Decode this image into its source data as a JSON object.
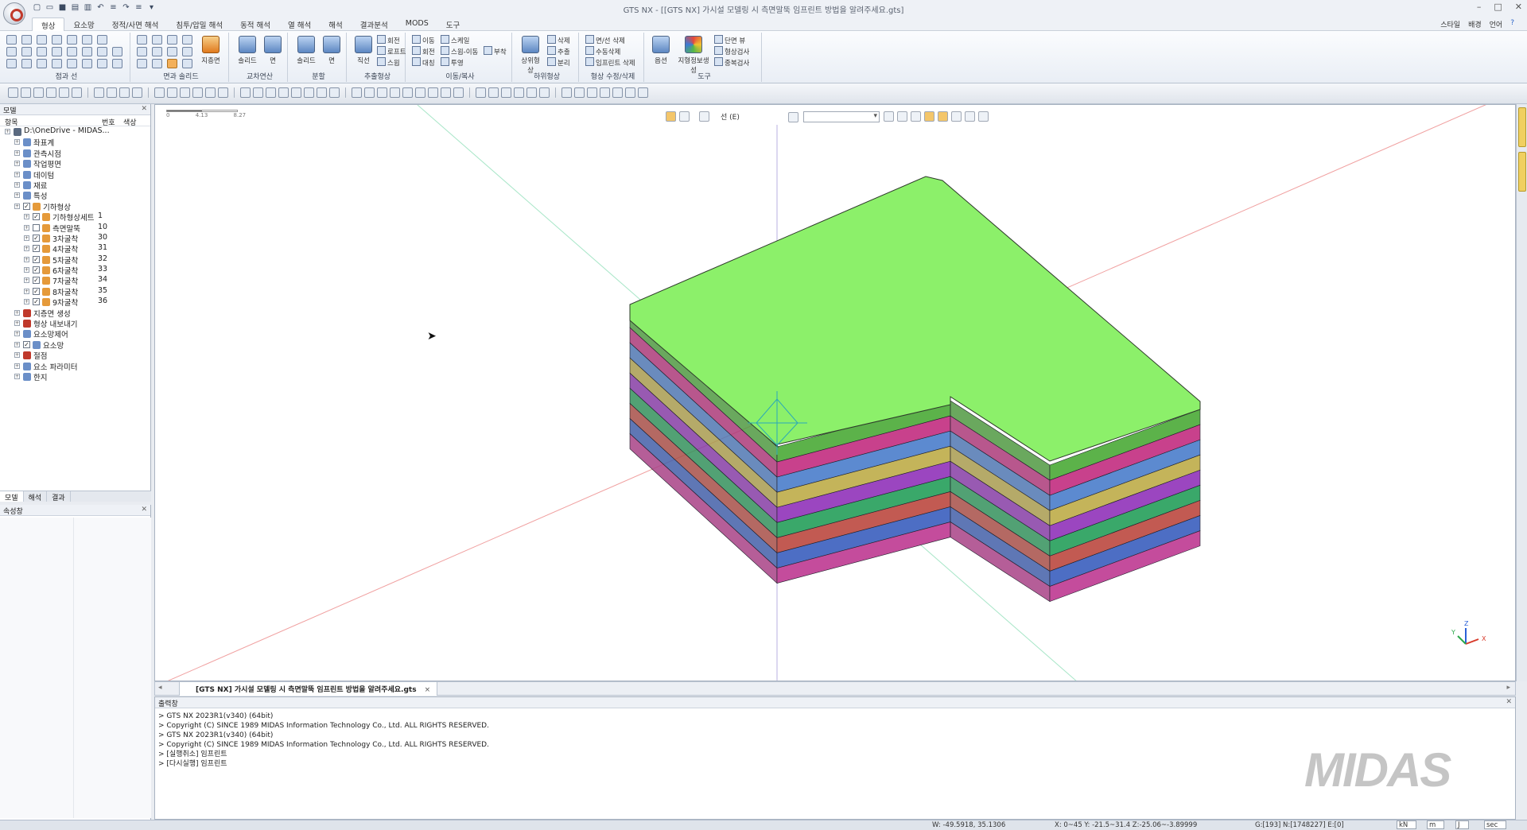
{
  "app": {
    "window_title": "GTS NX - [[GTS NX] 가시설 모델링 시 측면말뚝 임프린트 방법을 알려주세요.gts]",
    "window_controls": [
      "–",
      "□",
      "✕"
    ]
  },
  "ribbon_tabs": [
    "형상",
    "요소망",
    "정적/사면 해석",
    "침투/압밀 해석",
    "동적 해석",
    "열 해석",
    "해석",
    "결과분석",
    "MODS",
    "도구"
  ],
  "ribbon_right": [
    "스타일",
    "배경",
    "언어"
  ],
  "ribbon_groups": {
    "point_line": "점과 선",
    "surface_solid": "면과 솔리드",
    "cross": "교차연산",
    "split": "분할",
    "extract": "추출형상",
    "move_copy": "이동/복사",
    "sub_shape": "하위형상",
    "shape_edit": "형상 수정/삭제",
    "tools": "도구"
  },
  "ribbon_buttons": {
    "surface": "지층면",
    "solid": "솔리드",
    "face": "면",
    "split_solid": "솔리드",
    "split_face": "면",
    "extract_line": "직선",
    "rotate": "회전",
    "loft": "로프트",
    "sweep": "스윕",
    "move": "이동",
    "scale": "스케일",
    "turn": "회전",
    "sweep_move": "스윕-이동",
    "mirror": "대칭",
    "project": "투영",
    "attach": "부착",
    "sub_shape": "상위형상",
    "delete": "삭제",
    "extract2": "추출",
    "separate": "분리",
    "face_delete": "면/선 삭제",
    "manual_delete": "수동삭제",
    "imprint_delete": "임프린트 삭제",
    "option": "옵션",
    "geo_info": "지형정보생성",
    "section": "단면 뷰",
    "shape_check": "형상검사",
    "duplicate_check": "중복검사"
  },
  "model_panel": {
    "title": "모델",
    "col_item": "항목",
    "col_no": "번호",
    "col_color": "색상",
    "tree": [
      {
        "label": "D:\\OneDrive - MIDAS...",
        "num": "",
        "level": 0,
        "icon": "#5a6a80"
      },
      {
        "label": "좌표계",
        "num": "",
        "level": 1,
        "icon": "#6b8fc8"
      },
      {
        "label": "관측시점",
        "num": "",
        "level": 1,
        "icon": "#6b8fc8"
      },
      {
        "label": "작업평면",
        "num": "",
        "level": 1,
        "icon": "#6b8fc8"
      },
      {
        "label": "데이텀",
        "num": "",
        "level": 1,
        "icon": "#6b8fc8"
      },
      {
        "label": "재료",
        "num": "",
        "level": 1,
        "icon": "#6b8fc8"
      },
      {
        "label": "특성",
        "num": "",
        "level": 1,
        "icon": "#6b8fc8"
      },
      {
        "label": "기하형상",
        "num": "",
        "level": 1,
        "icon": "#e59a3a"
      },
      {
        "label": "기하형상세트",
        "num": "1",
        "level": 2,
        "icon": "#e59a3a"
      },
      {
        "label": "측면말뚝",
        "num": "10",
        "level": 2,
        "icon": "#e59a3a"
      },
      {
        "label": "3차굴착",
        "num": "30",
        "level": 2,
        "icon": "#e59a3a"
      },
      {
        "label": "4차굴착",
        "num": "31",
        "level": 2,
        "icon": "#e59a3a"
      },
      {
        "label": "5차굴착",
        "num": "32",
        "level": 2,
        "icon": "#e59a3a"
      },
      {
        "label": "6차굴착",
        "num": "33",
        "level": 2,
        "icon": "#e59a3a"
      },
      {
        "label": "7차굴착",
        "num": "34",
        "level": 2,
        "icon": "#e59a3a"
      },
      {
        "label": "8차굴착",
        "num": "35",
        "level": 2,
        "icon": "#e59a3a"
      },
      {
        "label": "9차굴착",
        "num": "36",
        "level": 2,
        "icon": "#e59a3a"
      },
      {
        "label": "지층면 생성",
        "num": "",
        "level": 1,
        "icon": "#c0392b"
      },
      {
        "label": "형상 내보내기",
        "num": "",
        "level": 1,
        "icon": "#c0392b"
      },
      {
        "label": "요소망제어",
        "num": "",
        "level": 1,
        "icon": "#6b8fc8"
      },
      {
        "label": "요소망",
        "num": "",
        "level": 1,
        "icon": "#6b8fc8"
      },
      {
        "label": "절점",
        "num": "",
        "level": 1,
        "icon": "#c0392b"
      },
      {
        "label": "요소 파라미터",
        "num": "",
        "level": 1,
        "icon": "#6b8fc8"
      },
      {
        "label": "한지",
        "num": "",
        "level": 1,
        "icon": "#6b8fc8"
      }
    ],
    "tabs": [
      "모델",
      "해석",
      "결과"
    ]
  },
  "props_panel": {
    "title": "속성창"
  },
  "viewport": {
    "scale_labels": [
      "0",
      "4.13",
      "8.27"
    ],
    "label": "선 (E)"
  },
  "document_tab": {
    "title": "[GTS NX] 가시설 모델링 시 측면말뚝 임프린트 방법을 알려주세요.gts",
    "close": "×"
  },
  "output_panel": {
    "title": "출력창",
    "lines": [
      "> GTS NX 2023R1(v340) (64bit)",
      "> Copyright (C) SINCE 1989 MIDAS Information Technology Co., Ltd. ALL RIGHTS RESERVED.",
      "> GTS NX 2023R1(v340) (64bit)",
      "> Copyright (C) SINCE 1989 MIDAS Information Technology Co., Ltd. ALL RIGHTS RESERVED.",
      "> [실행취소] 임프린트",
      "> [다시실행] 임프린트"
    ]
  },
  "watermark": "MIDAS",
  "status": {
    "w": "W: -49.5918, 35.1306",
    "coords": "X: 0~45 Y: -21.5~31.4 Z:-25.06~-3.89999",
    "counts": "G:[193] N:[1748227] E:[0]",
    "unit_force": "kN",
    "unit_length": "m",
    "unit_energy": "J",
    "unit_time": "sec"
  },
  "colors": {
    "top_green": "#8cf06a",
    "layer_colors": [
      "#5cb24a",
      "#c8418c",
      "#5c8ad0",
      "#c4b45a",
      "#9b46c0",
      "#3aa86a",
      "#c25a52",
      "#4d6ec4",
      "#c44c9c"
    ]
  }
}
